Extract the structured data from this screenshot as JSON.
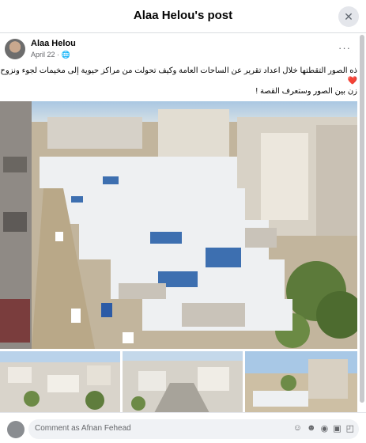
{
  "dialog": {
    "title": "Alaa Helou's post",
    "close_icon": "close-icon"
  },
  "post": {
    "author": "Alaa Helou",
    "date": "April 22",
    "privacy_icon": "globe-icon",
    "more_icon": "more-options-icon",
    "text_lines": [
      "ذه الصور التقطتها خلال اعداد تقرير عن الساحات العامة وكيف تحولت من مراكز حيوية إلى مخيمات لجوء ونزوح",
      "❤️",
      "زن بين الصور وستعرف القصة !"
    ]
  },
  "comment": {
    "placeholder": "Comment as Afnan Fehead",
    "icons": [
      "avatar-sticker-icon",
      "emoji-icon",
      "camera-icon",
      "gif-icon",
      "sticker-icon"
    ]
  }
}
